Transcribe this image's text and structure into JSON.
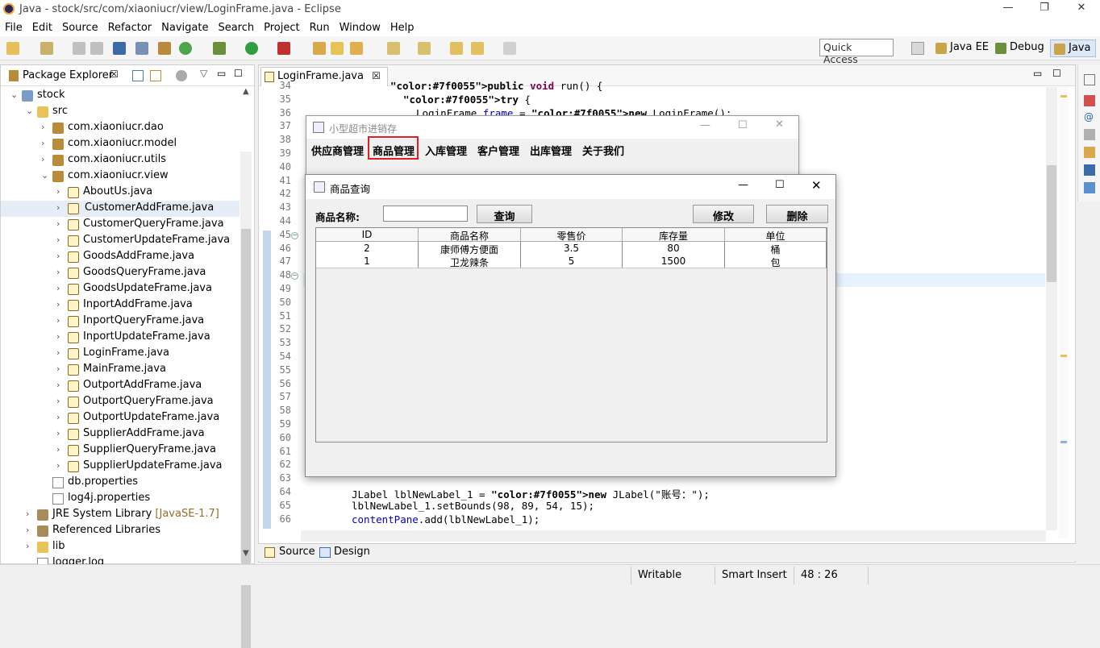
{
  "window": {
    "title": "Java - stock/src/com/xiaoniucr/view/LoginFrame.java - Eclipse",
    "minimize": "—",
    "restore": "❐",
    "close": "✕"
  },
  "menu": [
    "File",
    "Edit",
    "Source",
    "Refactor",
    "Navigate",
    "Search",
    "Project",
    "Run",
    "Window",
    "Help"
  ],
  "toolbar": {
    "quick_access": "Quick Access",
    "perspectives": [
      "Java EE",
      "Debug",
      "Java"
    ]
  },
  "package_explorer": {
    "title": "Package Explorer",
    "close": "☒",
    "items": [
      {
        "label": "stock",
        "icon": "project-icon",
        "level": 0,
        "arrow": "⌄"
      },
      {
        "label": "src",
        "icon": "folder-icon",
        "level": 1,
        "arrow": "⌄"
      },
      {
        "label": "com.xiaoniucr.dao",
        "icon": "package-icon",
        "level": 2,
        "arrow": "›"
      },
      {
        "label": "com.xiaoniucr.model",
        "icon": "package-icon",
        "level": 2,
        "arrow": "›"
      },
      {
        "label": "com.xiaoniucr.utils",
        "icon": "package-icon",
        "level": 2,
        "arrow": "›"
      },
      {
        "label": "com.xiaoniucr.view",
        "icon": "package-icon",
        "level": 2,
        "arrow": "⌄"
      },
      {
        "label": "AboutUs.java",
        "icon": "java-file-icon",
        "level": 3,
        "arrow": "›"
      },
      {
        "label": "CustomerAddFrame.java",
        "icon": "java-file-icon",
        "level": 3,
        "arrow": "›",
        "selected": true
      },
      {
        "label": "CustomerQueryFrame.java",
        "icon": "java-file-icon",
        "level": 3,
        "arrow": "›"
      },
      {
        "label": "CustomerUpdateFrame.java",
        "icon": "java-file-icon",
        "level": 3,
        "arrow": "›"
      },
      {
        "label": "GoodsAddFrame.java",
        "icon": "java-file-icon",
        "level": 3,
        "arrow": "›"
      },
      {
        "label": "GoodsQueryFrame.java",
        "icon": "java-file-icon",
        "level": 3,
        "arrow": "›"
      },
      {
        "label": "GoodsUpdateFrame.java",
        "icon": "java-file-icon",
        "level": 3,
        "arrow": "›"
      },
      {
        "label": "InportAddFrame.java",
        "icon": "java-file-icon",
        "level": 3,
        "arrow": "›"
      },
      {
        "label": "InportQueryFrame.java",
        "icon": "java-file-icon",
        "level": 3,
        "arrow": "›"
      },
      {
        "label": "InportUpdateFrame.java",
        "icon": "java-file-icon",
        "level": 3,
        "arrow": "›"
      },
      {
        "label": "LoginFrame.java",
        "icon": "java-file-icon",
        "level": 3,
        "arrow": "›"
      },
      {
        "label": "MainFrame.java",
        "icon": "java-file-icon",
        "level": 3,
        "arrow": "›"
      },
      {
        "label": "OutportAddFrame.java",
        "icon": "java-file-icon",
        "level": 3,
        "arrow": "›"
      },
      {
        "label": "OutportQueryFrame.java",
        "icon": "java-file-icon",
        "level": 3,
        "arrow": "›"
      },
      {
        "label": "OutportUpdateFrame.java",
        "icon": "java-file-icon",
        "level": 3,
        "arrow": "›"
      },
      {
        "label": "SupplierAddFrame.java",
        "icon": "java-file-icon",
        "level": 3,
        "arrow": "›"
      },
      {
        "label": "SupplierQueryFrame.java",
        "icon": "java-file-icon",
        "level": 3,
        "arrow": "›"
      },
      {
        "label": "SupplierUpdateFrame.java",
        "icon": "java-file-icon",
        "level": 3,
        "arrow": "›"
      },
      {
        "label": "db.properties",
        "icon": "properties-file-icon",
        "level": 2,
        "arrow": ""
      },
      {
        "label": "log4j.properties",
        "icon": "properties-file-icon",
        "level": 2,
        "arrow": ""
      },
      {
        "label": "JRE System Library",
        "suffix": "[JavaSE-1.7]",
        "icon": "library-icon",
        "level": 1,
        "arrow": "›"
      },
      {
        "label": "Referenced Libraries",
        "icon": "library-icon",
        "level": 1,
        "arrow": "›"
      },
      {
        "label": "lib",
        "icon": "folder-icon",
        "level": 1,
        "arrow": "›"
      },
      {
        "label": "logger.log",
        "icon": "properties-file-icon",
        "level": 1,
        "arrow": ""
      }
    ]
  },
  "editor": {
    "tab": "LoginFrame.java",
    "tab_close": "☒",
    "line_numbers": [
      "34",
      "35",
      "36",
      "37",
      "38",
      "39",
      "40",
      "41",
      "42",
      "43",
      "44",
      "45",
      "46",
      "47",
      "48",
      "49",
      "50",
      "51",
      "52",
      "53",
      "54",
      "55",
      "56",
      "57",
      "58",
      "59",
      "60",
      "61",
      "62",
      "63",
      "64",
      "65",
      "66"
    ],
    "code_top": [
      {
        "text": "public void run() {",
        "line": 0,
        "indent": 6
      },
      {
        "text": "try {",
        "line": 1,
        "indent": 8
      },
      {
        "text": "LoginFrame frame = new LoginFrame();",
        "line": 2,
        "indent": 10
      }
    ],
    "code_bottom": [
      {
        "text": "JLabel lblNewLabel_1 = new JLabel(\"账号：\");",
        "line": 30
      },
      {
        "text": "lblNewLabel_1.setBounds(98, 89, 54, 15);",
        "line": 31
      },
      {
        "text": "contentPane.add(lblNewLabel_1);",
        "line": 32
      }
    ],
    "bottom_tabs": [
      "Source",
      "Design"
    ]
  },
  "status": {
    "writable": "Writable",
    "insert": "Smart Insert",
    "position": "48 : 26"
  },
  "main_frame": {
    "title": "小型超市进销存",
    "menu": [
      "供应商管理",
      "商品管理",
      "入库管理",
      "客户管理",
      "出库管理",
      "关于我们"
    ]
  },
  "query_frame": {
    "title": "商品查询",
    "name_label": "商品名称:",
    "name_value": "",
    "query_button": "查询",
    "edit_button": "修改",
    "delete_button": "删除",
    "columns": [
      "ID",
      "商品名称",
      "零售价",
      "库存量",
      "单位"
    ],
    "rows": [
      [
        "2",
        "康师傅方便面",
        "3.5",
        "80",
        "桶"
      ],
      [
        "1",
        "卫龙辣条",
        "5",
        "1500",
        "包"
      ]
    ]
  }
}
